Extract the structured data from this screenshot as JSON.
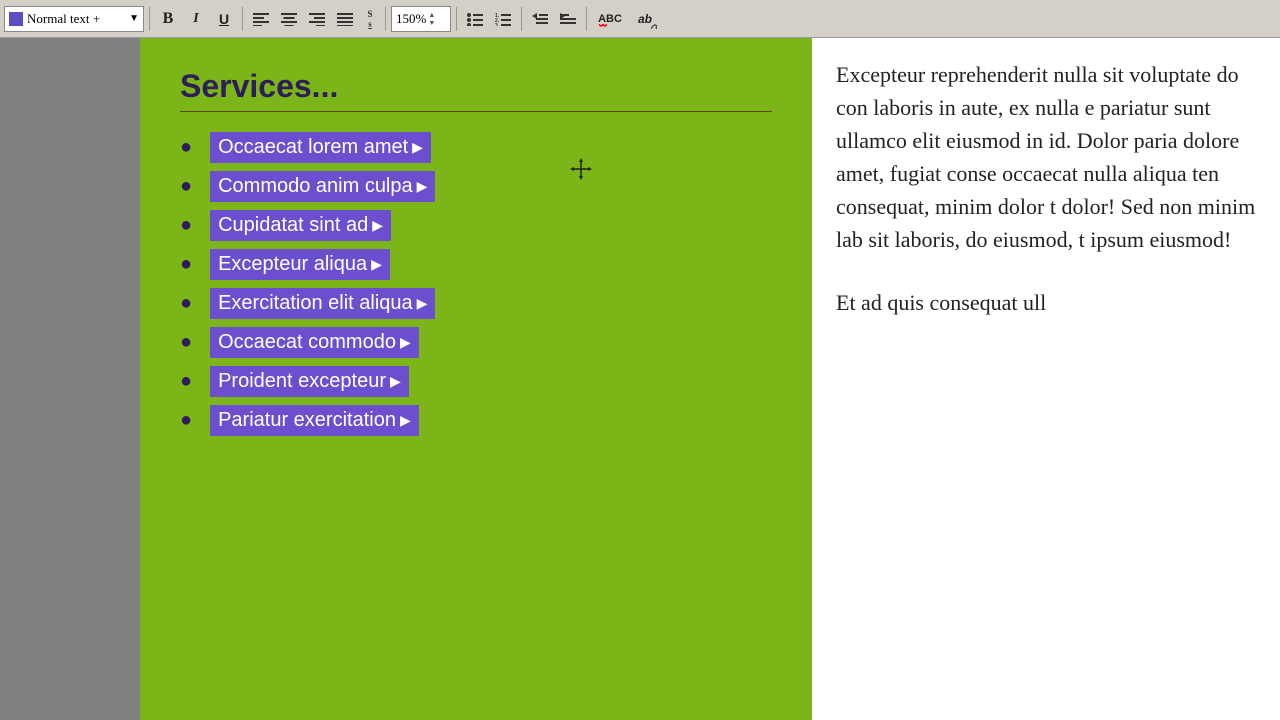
{
  "toolbar": {
    "style_label": "Normal text +",
    "bold_label": "B",
    "italic_label": "I",
    "underline_label": "U",
    "superscript_label": "s",
    "subscript_label": "s",
    "zoom_value": "150%",
    "align_left_label": "align-left",
    "align_center_label": "align-center",
    "align_right_label": "align-right",
    "align_justify_label": "align-justify",
    "list_unordered_label": "list",
    "list_ordered_label": "list-num",
    "outdent_label": "outdent",
    "indent_label": "indent",
    "spellcheck_label": "ABC",
    "autocorrect_label": "ab"
  },
  "green_panel": {
    "title": "Services...",
    "items": [
      {
        "text": "Occaecat lorem amet",
        "has_arrow": true
      },
      {
        "text": "Commodo anim culpa",
        "has_arrow": true
      },
      {
        "text": "Cupidatat sint ad",
        "has_arrow": true
      },
      {
        "text": "Excepteur aliqua",
        "has_arrow": true
      },
      {
        "text": "Exercitation elit aliqua",
        "has_arrow": true
      },
      {
        "text": "Occaecat commodo",
        "has_arrow": true
      },
      {
        "text": "Proident excepteur",
        "has_arrow": true
      },
      {
        "text": "Pariatur exercitation",
        "has_arrow": true
      }
    ]
  },
  "right_panel": {
    "paragraph1": "Excepteur reprehenderit nulla sit voluptate do con laboris in aute, ex nulla e pariatur sunt ullamco elit eiusmod in id. Dolor paria dolore amet, fugiat conse occaecat nulla aliqua ten consequat, minim dolor t dolor! Sed non minim lab sit laboris, do eiusmod, t ipsum eiusmod!",
    "paragraph2": "Et ad quis consequat ull"
  }
}
